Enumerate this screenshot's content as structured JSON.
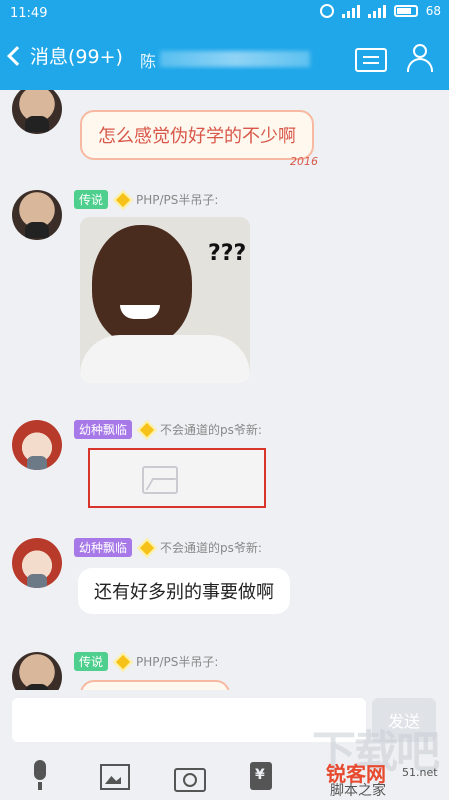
{
  "status_bar": {
    "time": "11:49",
    "battery": "68"
  },
  "nav": {
    "back_label": "消息(99+)",
    "title": "陈"
  },
  "messages": [
    {
      "sender_title": "",
      "sender_name": "",
      "text": "怎么感觉伪好学的不少啊",
      "style": "decorated",
      "decoration": "2016"
    },
    {
      "sender_title": "传说",
      "sender_name": "PHP/PS半吊子:",
      "type": "image",
      "image_text": "???"
    },
    {
      "sender_title": "幼种飘临",
      "sender_name": "不会通道的ps爷新:",
      "type": "image-failed"
    },
    {
      "sender_title": "幼种飘临",
      "sender_name": "不会通道的ps爷新:",
      "text": "还有好多别的事要做啊"
    },
    {
      "sender_title": "传说",
      "sender_name": "PHP/PS半吊子:",
      "text": ""
    }
  ],
  "input": {
    "placeholder": "",
    "send_label": "发送"
  },
  "toolbar": {
    "icons": [
      "mic-icon",
      "image-icon",
      "camera-icon",
      "red-packet-icon"
    ]
  },
  "watermark": {
    "big": "下载吧",
    "brand": "锐客网",
    "sub": "脚本之家",
    "url": "51.net"
  }
}
